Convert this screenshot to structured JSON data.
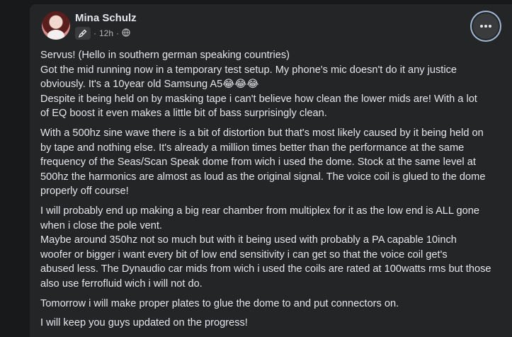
{
  "post": {
    "author": "Mina Schulz",
    "time": "12h",
    "separator": "·",
    "paragraphs": [
      {
        "lines": [
          "Servus! (Hello in southern german speaking countries)",
          "Got the mid running now in a temporary test setup. My phone's mic doesn't do it any justice",
          "obviously. It's a 10year old Samsung A5😂😂😂",
          "Despite it being held on by masking tape i can't believe how clean the lower mids are! With a lot",
          "of EQ boost it even makes a little bit of bass surprisingly clean."
        ]
      },
      {
        "lines": [
          "With a 500hz sine wave there is a bit of distortion but that's most likely caused by it being held on",
          "by tape and nothing else. It's already a million times better than the performance at the same",
          "frequency of the Seas/Scan Speak dome from wich i used the dome. Stock at the same level at",
          "500hz the harmonics are almost as loud as the original signal. The voice coil is glued to the dome",
          "properly off course!"
        ]
      },
      {
        "lines": [
          "I will probably end up making a big rear chamber from multiplex for it as the low end is ALL gone",
          "when i close the pole vent.",
          "Maybe around 350hz not so much but with it being used with probably a PA capable 10inch",
          "woofer or bigger i want every bit of low end sensitivity i can get so that the voice coil get's",
          "abused less. The Dynaudio car mids from wich i used the coils are rated at 100watts rms but those",
          "also use ferrofluid wich i will not do."
        ]
      },
      {
        "lines": [
          "Tomorrow i will make proper plates to glue the dome to and put connectors on."
        ]
      },
      {
        "lines": [
          "I will keep you guys updated on the progress!"
        ]
      }
    ]
  },
  "icons": {
    "badge": "pencil-icon",
    "audience": "globe-icon",
    "menu": "more-horizontal-icon"
  }
}
